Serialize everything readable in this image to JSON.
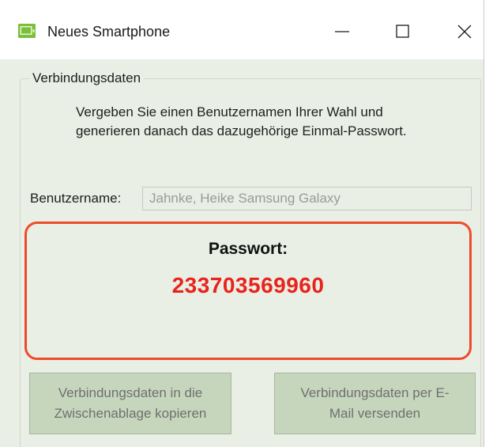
{
  "window": {
    "title": "Neues Smartphone",
    "icon": "smartphone-app-icon",
    "controls": [
      "minimize-icon",
      "maximize-icon",
      "close-icon"
    ]
  },
  "group": {
    "legend": "Verbindungsdaten",
    "instructions": "Vergeben Sie einen Benutzernamen Ihrer Wahl und generieren danach das dazugehörige Einmal-Passwort."
  },
  "username": {
    "label": "Benutzername:",
    "value": "Jahnke, Heike Samsung Galaxy"
  },
  "password": {
    "label": "Passwort:",
    "value": "233703569960"
  },
  "buttons": {
    "copy_line1": "Verbindungsdaten in die",
    "copy_line2": "Zwischenablage kopieren",
    "mail_line1": "Verbindungsdaten per E-",
    "mail_line2": "Mail versenden"
  },
  "colors": {
    "window_bg": "#e9efe4",
    "password_border": "#ee4b2b",
    "password_value": "#e8231c",
    "button_bg": "#c6d6bc",
    "icon_green": "#7cbf3a"
  }
}
